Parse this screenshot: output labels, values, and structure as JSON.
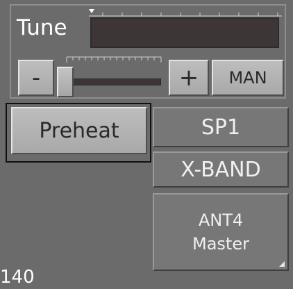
{
  "tune": {
    "label": "Tune",
    "minus_label": "-",
    "plus_label": "+",
    "man_label": "MAN"
  },
  "buttons": {
    "preheat": "Preheat",
    "sp1": "SP1",
    "xband": "X-BAND",
    "ant4_line1": "ANT4",
    "ant4_line2": "Master"
  },
  "status": {
    "value": "140"
  }
}
